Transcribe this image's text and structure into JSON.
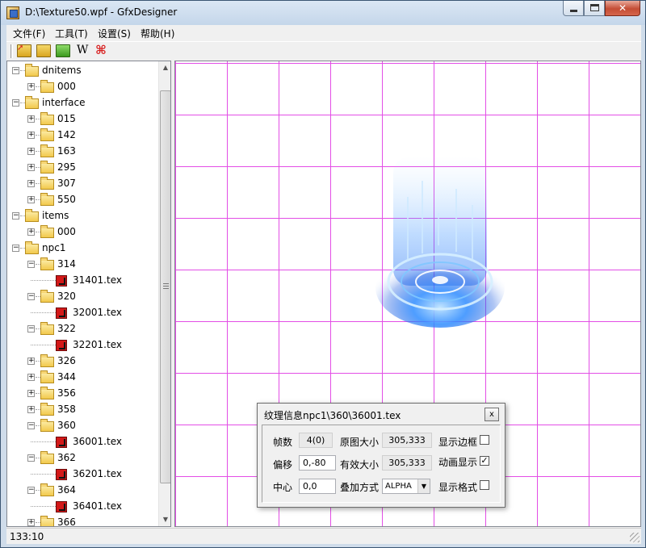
{
  "window": {
    "title": "D:\\Texture50.wpf - GfxDesigner"
  },
  "menubar": {
    "items": [
      "文件(F)",
      "工具(T)",
      "设置(S)",
      "帮助(H)"
    ]
  },
  "toolbar": {
    "icons": [
      "open-folder-icon",
      "save-folder-icon",
      "green-folder-icon",
      "w-icon",
      "grid-x-icon"
    ],
    "w_label": "W"
  },
  "tree": {
    "items": [
      {
        "label": "dnitems",
        "level": 0,
        "type": "folder",
        "expanded": true
      },
      {
        "label": "000",
        "level": 1,
        "type": "folder",
        "expanded": false
      },
      {
        "label": "interface",
        "level": 0,
        "type": "folder",
        "expanded": true
      },
      {
        "label": "015",
        "level": 1,
        "type": "folder",
        "expanded": false
      },
      {
        "label": "142",
        "level": 1,
        "type": "folder",
        "expanded": false
      },
      {
        "label": "163",
        "level": 1,
        "type": "folder",
        "expanded": false
      },
      {
        "label": "295",
        "level": 1,
        "type": "folder",
        "expanded": false
      },
      {
        "label": "307",
        "level": 1,
        "type": "folder",
        "expanded": false
      },
      {
        "label": "550",
        "level": 1,
        "type": "folder",
        "expanded": false
      },
      {
        "label": "items",
        "level": 0,
        "type": "folder",
        "expanded": true
      },
      {
        "label": "000",
        "level": 1,
        "type": "folder",
        "expanded": false
      },
      {
        "label": "npc1",
        "level": 0,
        "type": "folder",
        "expanded": true
      },
      {
        "label": "314",
        "level": 1,
        "type": "folder",
        "expanded": true
      },
      {
        "label": "31401.tex",
        "level": 2,
        "type": "file"
      },
      {
        "label": "320",
        "level": 1,
        "type": "folder",
        "expanded": true
      },
      {
        "label": "32001.tex",
        "level": 2,
        "type": "file"
      },
      {
        "label": "322",
        "level": 1,
        "type": "folder",
        "expanded": true
      },
      {
        "label": "32201.tex",
        "level": 2,
        "type": "file"
      },
      {
        "label": "326",
        "level": 1,
        "type": "folder",
        "expanded": false
      },
      {
        "label": "344",
        "level": 1,
        "type": "folder",
        "expanded": false
      },
      {
        "label": "356",
        "level": 1,
        "type": "folder",
        "expanded": false
      },
      {
        "label": "358",
        "level": 1,
        "type": "folder",
        "expanded": false
      },
      {
        "label": "360",
        "level": 1,
        "type": "folder",
        "expanded": true
      },
      {
        "label": "36001.tex",
        "level": 2,
        "type": "file"
      },
      {
        "label": "362",
        "level": 1,
        "type": "folder",
        "expanded": true
      },
      {
        "label": "36201.tex",
        "level": 2,
        "type": "file"
      },
      {
        "label": "364",
        "level": 1,
        "type": "folder",
        "expanded": true
      },
      {
        "label": "36401.tex",
        "level": 2,
        "type": "file"
      },
      {
        "label": "366",
        "level": 1,
        "type": "folder",
        "expanded": false
      }
    ]
  },
  "dialog": {
    "title": "纹理信息npc1\\360\\36001.tex",
    "close_label": "x",
    "frames_label": "帧数",
    "frames_value": "4(0)",
    "orig_size_label": "原图大小",
    "orig_size_value": "305,333",
    "show_border_label": "显示边框",
    "show_border_checked": false,
    "offset_label": "偏移",
    "offset_value": "0,-80",
    "valid_size_label": "有效大小",
    "valid_size_value": "305,333",
    "anim_label": "动画显示",
    "anim_checked": true,
    "center_label": "中心",
    "center_value": "0,0",
    "blend_label": "叠加方式",
    "blend_value": "ALPHA",
    "show_grid_label": "显示格式",
    "show_grid_checked": false
  },
  "statusbar": {
    "text": "133:10"
  },
  "colors": {
    "grid_line": "#e34ee6",
    "effect_glow": "#2f8cff"
  }
}
